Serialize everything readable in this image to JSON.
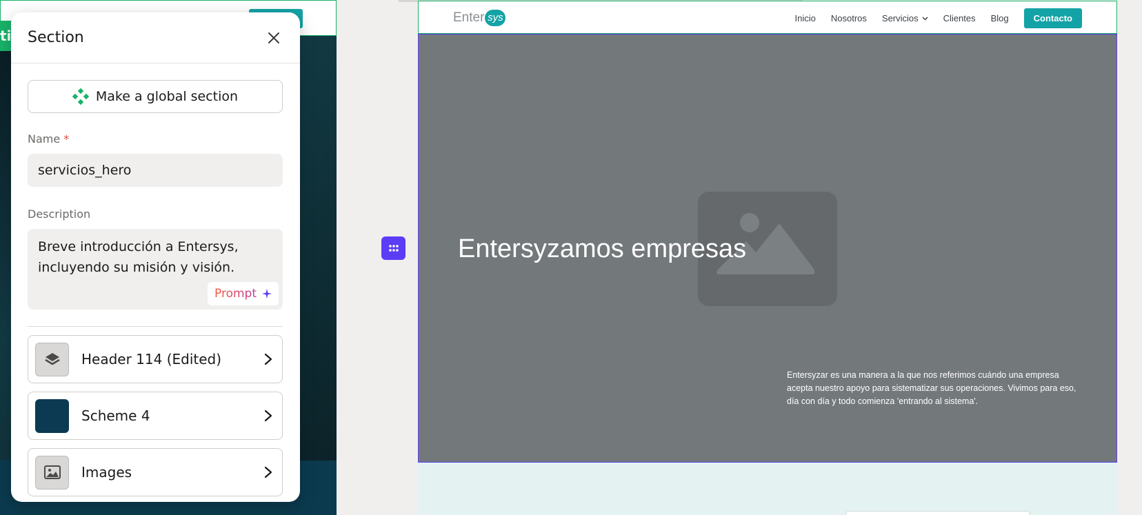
{
  "background_preview": {
    "partial_tab_text": "ti"
  },
  "panel": {
    "title": "Section",
    "global_button_label": "Make a global section",
    "name_label": "Name",
    "name_required_mark": "*",
    "name_value": "servicios_hero",
    "description_label": "Description",
    "description_value": "Breve introducción a Entersys, incluyendo su misión y visión.",
    "prompt_label": "Prompt",
    "rows": [
      {
        "label": "Header 114 (Edited)",
        "icon": "layers-icon"
      },
      {
        "label": "Scheme 4",
        "icon": "color-swatch",
        "color": "#0b3a52"
      },
      {
        "label": "Images",
        "icon": "image-icon"
      }
    ]
  },
  "site": {
    "logo_text": "Enter",
    "logo_badge": "sys",
    "nav": [
      "Inicio",
      "Nosotros",
      "Servicios",
      "Clientes",
      "Blog"
    ],
    "cta": "Contacto",
    "hero_title": "Entersyzamos empresas",
    "hero_text": "Entersyzar es una manera a la que nos referimos cuándo una empresa acepta nuestro apoyo para sistematizar sus operaciones. Vivimos para eso, día con día y todo comienza 'entrando al sistema'."
  },
  "colors": {
    "accent_purple": "#5b3df5",
    "brand_teal": "#13a3a6",
    "success_green": "#19b36b",
    "hero_overlay": "#73787b"
  }
}
